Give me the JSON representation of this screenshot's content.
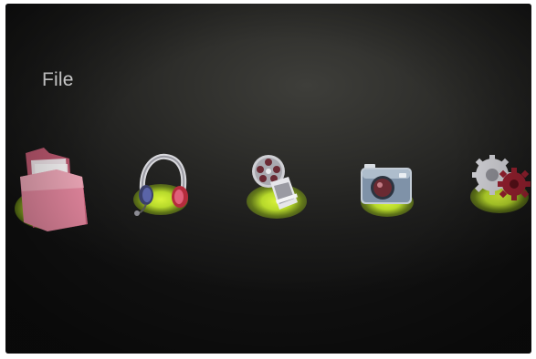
{
  "header": {
    "title": "File"
  },
  "menu": {
    "items": [
      {
        "id": "file",
        "icon": "folder-icon",
        "selected": true
      },
      {
        "id": "music",
        "icon": "headphones-icon",
        "selected": false
      },
      {
        "id": "movie",
        "icon": "film-reel-icon",
        "selected": false
      },
      {
        "id": "photo",
        "icon": "camera-icon",
        "selected": false
      },
      {
        "id": "setup",
        "icon": "gear-icon",
        "selected": false
      }
    ]
  },
  "colors": {
    "background": "#2a2a28",
    "highlight_glow": "#c9e633",
    "text": "#f2f2f2"
  }
}
